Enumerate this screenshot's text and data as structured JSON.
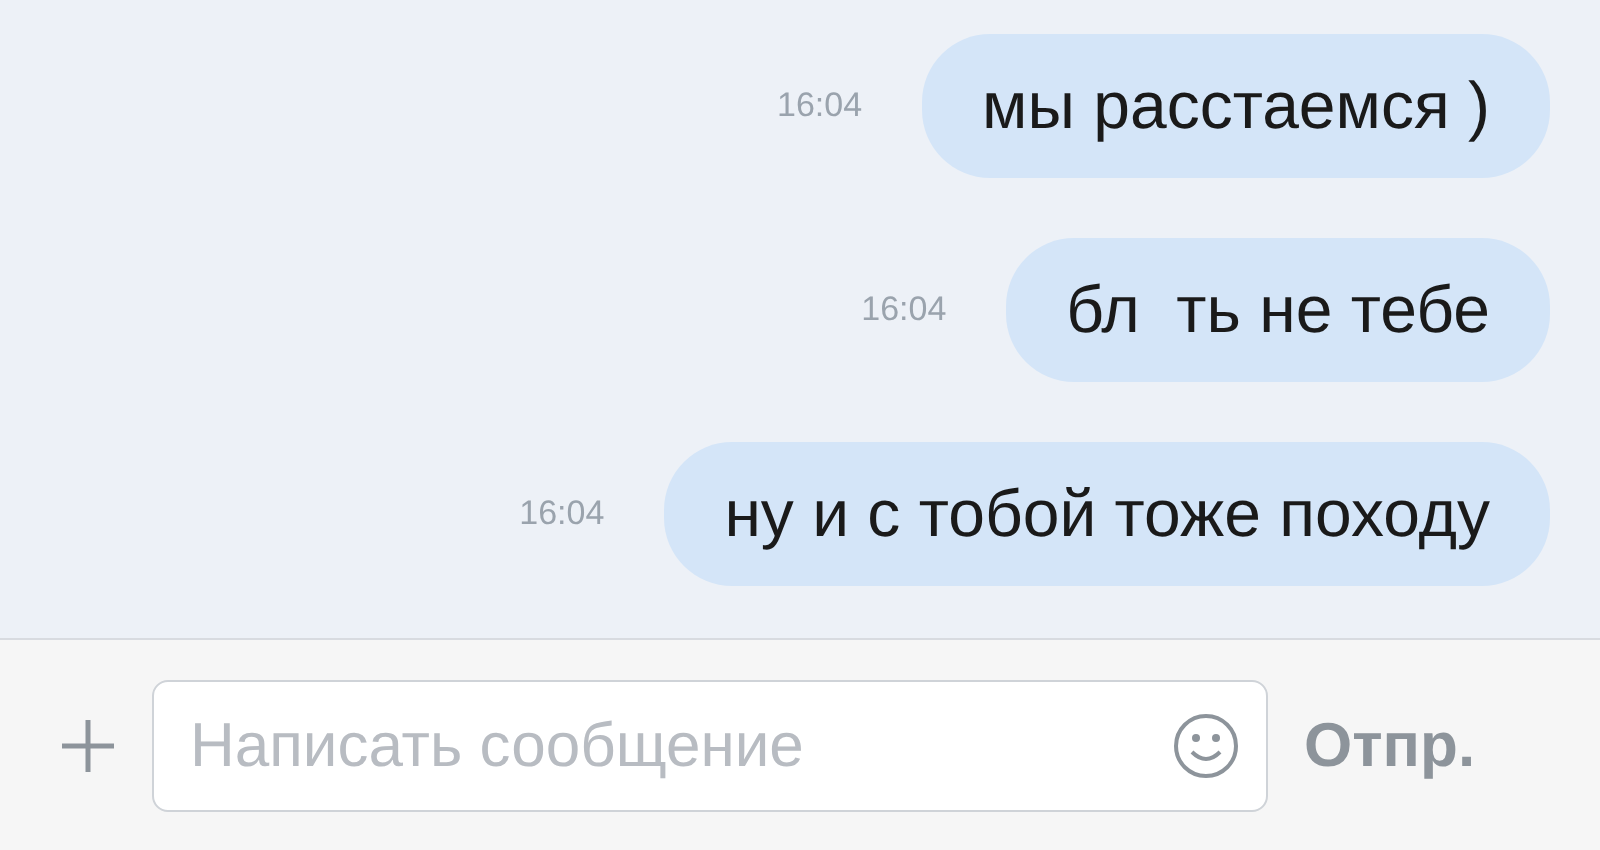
{
  "messages": [
    {
      "time": "16:04",
      "text": "мы расстаемся )"
    },
    {
      "time": "16:04",
      "text": "бл  ть не тебе"
    },
    {
      "time": "16:04",
      "text": "ну и с тобой тоже походу"
    }
  ],
  "composer": {
    "placeholder": "Написать сообщение",
    "send": "Отпр."
  }
}
